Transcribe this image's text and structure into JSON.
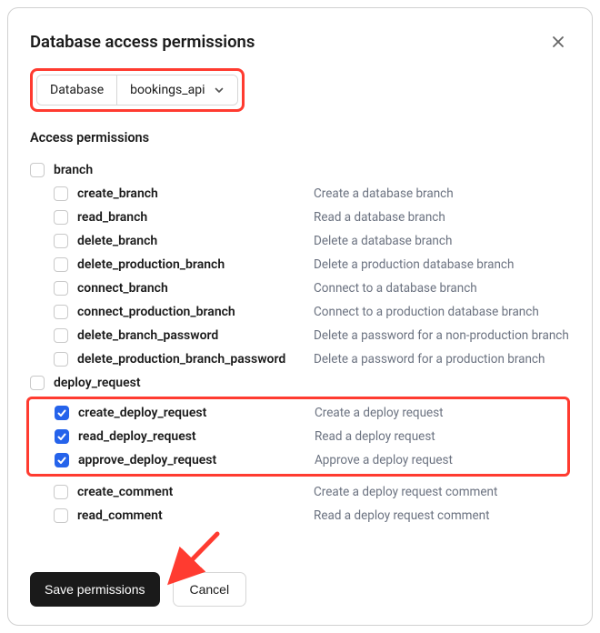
{
  "modal": {
    "title": "Database access permissions",
    "selector_label": "Database",
    "selector_value": "bookings_api",
    "section_heading": "Access permissions"
  },
  "groups": [
    {
      "name": "branch",
      "checked": false,
      "perms": [
        {
          "name": "create_branch",
          "desc": "Create a database branch",
          "checked": false
        },
        {
          "name": "read_branch",
          "desc": "Read a database branch",
          "checked": false
        },
        {
          "name": "delete_branch",
          "desc": "Delete a database branch",
          "checked": false
        },
        {
          "name": "delete_production_branch",
          "desc": "Delete a production database branch",
          "checked": false
        },
        {
          "name": "connect_branch",
          "desc": "Connect to a database branch",
          "checked": false
        },
        {
          "name": "connect_production_branch",
          "desc": "Connect to a production database branch",
          "checked": false
        },
        {
          "name": "delete_branch_password",
          "desc": "Delete a password for a non-production branch",
          "checked": false
        },
        {
          "name": "delete_production_branch_password",
          "desc": "Delete a password for a production branch",
          "checked": false
        }
      ]
    },
    {
      "name": "deploy_request",
      "checked": false,
      "highlighted_perms": [
        {
          "name": "create_deploy_request",
          "desc": "Create a deploy request",
          "checked": true
        },
        {
          "name": "read_deploy_request",
          "desc": "Read a deploy request",
          "checked": true
        },
        {
          "name": "approve_deploy_request",
          "desc": "Approve a deploy request",
          "checked": true
        }
      ],
      "perms": [
        {
          "name": "create_comment",
          "desc": "Create a deploy request comment",
          "checked": false
        },
        {
          "name": "read_comment",
          "desc": "Read a deploy request comment",
          "checked": false
        }
      ]
    }
  ],
  "footer": {
    "save": "Save permissions",
    "cancel": "Cancel"
  },
  "annotation": {
    "highlight_color": "#ff3b30",
    "arrow_color": "#ff3b30"
  }
}
